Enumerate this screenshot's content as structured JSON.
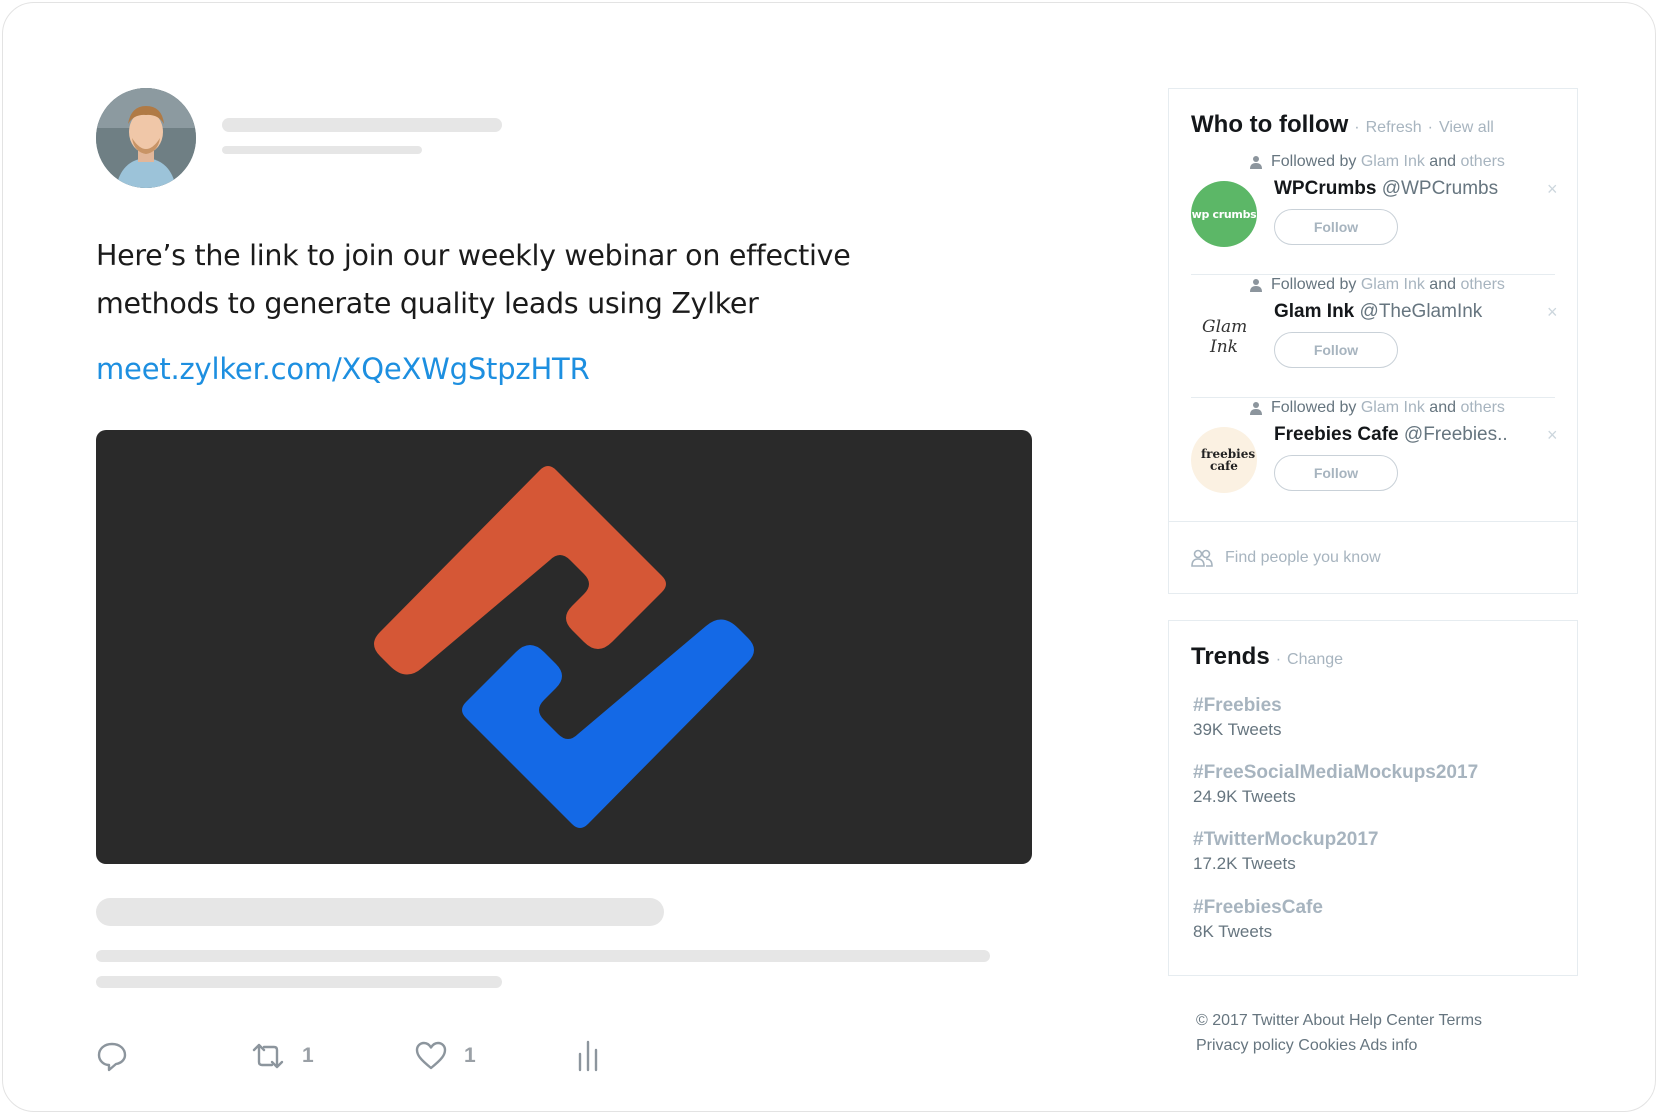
{
  "tweet": {
    "text": "Here’s the link to join our weekly webinar on effective methods to generate quality leads using Zylker",
    "link": "meet.zylker.com/XQeXWgStpzHTR",
    "retweet_count": "1",
    "like_count": "1"
  },
  "who_to_follow": {
    "title": "Who to follow",
    "refresh_label": "Refresh",
    "view_all_label": "View all",
    "suggestions": [
      {
        "followed_prefix": "Followed by",
        "followed_by": "Glam Ink",
        "followed_and": "and",
        "followed_others": "others",
        "name": "WPCrumbs",
        "handle": "@WPCrumbs",
        "avatar_text": "wp crumbs",
        "follow_label": "Follow",
        "dismiss": "×"
      },
      {
        "followed_prefix": "Followed by",
        "followed_by": "Glam Ink",
        "followed_and": "and",
        "followed_others": "others",
        "name": "Glam Ink",
        "handle": "@TheGlamInk",
        "avatar_text": "Glam Ink",
        "follow_label": "Follow",
        "dismiss": "×"
      },
      {
        "followed_prefix": "Followed by",
        "followed_by": "Glam Ink",
        "followed_and": "and",
        "followed_others": "others",
        "name": "Freebies Cafe",
        "handle": "@Freebies..",
        "avatar_text": "freebies cafe",
        "follow_label": "Follow",
        "dismiss": "×"
      }
    ],
    "find_people_label": "Find people you know"
  },
  "trends": {
    "title": "Trends",
    "change_label": "Change",
    "items": [
      {
        "tag": "#Freebies",
        "count": "39K Tweets"
      },
      {
        "tag": "#FreeSocialMediaMockups2017",
        "count": "24.9K Tweets"
      },
      {
        "tag": "#TwitterMockup2017",
        "count": "17.2K Tweets"
      },
      {
        "tag": "#FreebiesCafe",
        "count": "8K Tweets"
      }
    ]
  },
  "footer": {
    "copyright": "© 2017 Twitter",
    "about": "About",
    "help": "Help Center",
    "terms": "Terms",
    "privacy": "Privacy policy",
    "cookies": "Cookies",
    "ads": "Ads info"
  },
  "colors": {
    "link": "#1d8fe0",
    "media_bg": "#2a2a2a",
    "logo_orange": "#d55736",
    "logo_blue": "#1469e6",
    "wpcrumbs_green": "#5cb767"
  }
}
